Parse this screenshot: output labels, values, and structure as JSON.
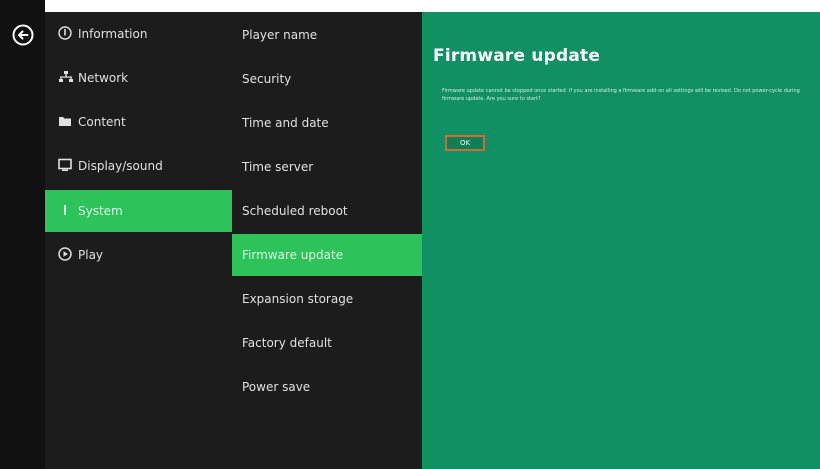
{
  "colors": {
    "accent": "#2ec25a",
    "panel": "#109063",
    "menu_bg": "#1c1c1c",
    "ok_border": "#d06a3a"
  },
  "back_button": {
    "icon": "arrow-left-circle-icon"
  },
  "main_menu": {
    "items": [
      {
        "label": "Information",
        "icon": "info-icon",
        "active": false
      },
      {
        "label": "Network",
        "icon": "network-icon",
        "active": false
      },
      {
        "label": "Content",
        "icon": "folder-icon",
        "active": false
      },
      {
        "label": "Display/sound",
        "icon": "monitor-icon",
        "active": false
      },
      {
        "label": "System",
        "icon": "system-icon",
        "active": true
      },
      {
        "label": "Play",
        "icon": "play-icon",
        "active": false
      }
    ]
  },
  "sub_menu": {
    "items": [
      {
        "label": "Player name",
        "active": false
      },
      {
        "label": "Security",
        "active": false
      },
      {
        "label": "Time and date",
        "active": false
      },
      {
        "label": "Time server",
        "active": false
      },
      {
        "label": "Scheduled reboot",
        "active": false
      },
      {
        "label": "Firmware update",
        "active": true
      },
      {
        "label": "Expansion storage",
        "active": false
      },
      {
        "label": "Factory default",
        "active": false
      },
      {
        "label": "Power save",
        "active": false
      }
    ]
  },
  "panel": {
    "title": "Firmware update",
    "description": "Firmware update cannot be stopped once started. If you are installing a firmware add-on all settings will be revised. Do not power-cycle during firmware update. Are you sure to start?",
    "ok_label": "OK"
  }
}
